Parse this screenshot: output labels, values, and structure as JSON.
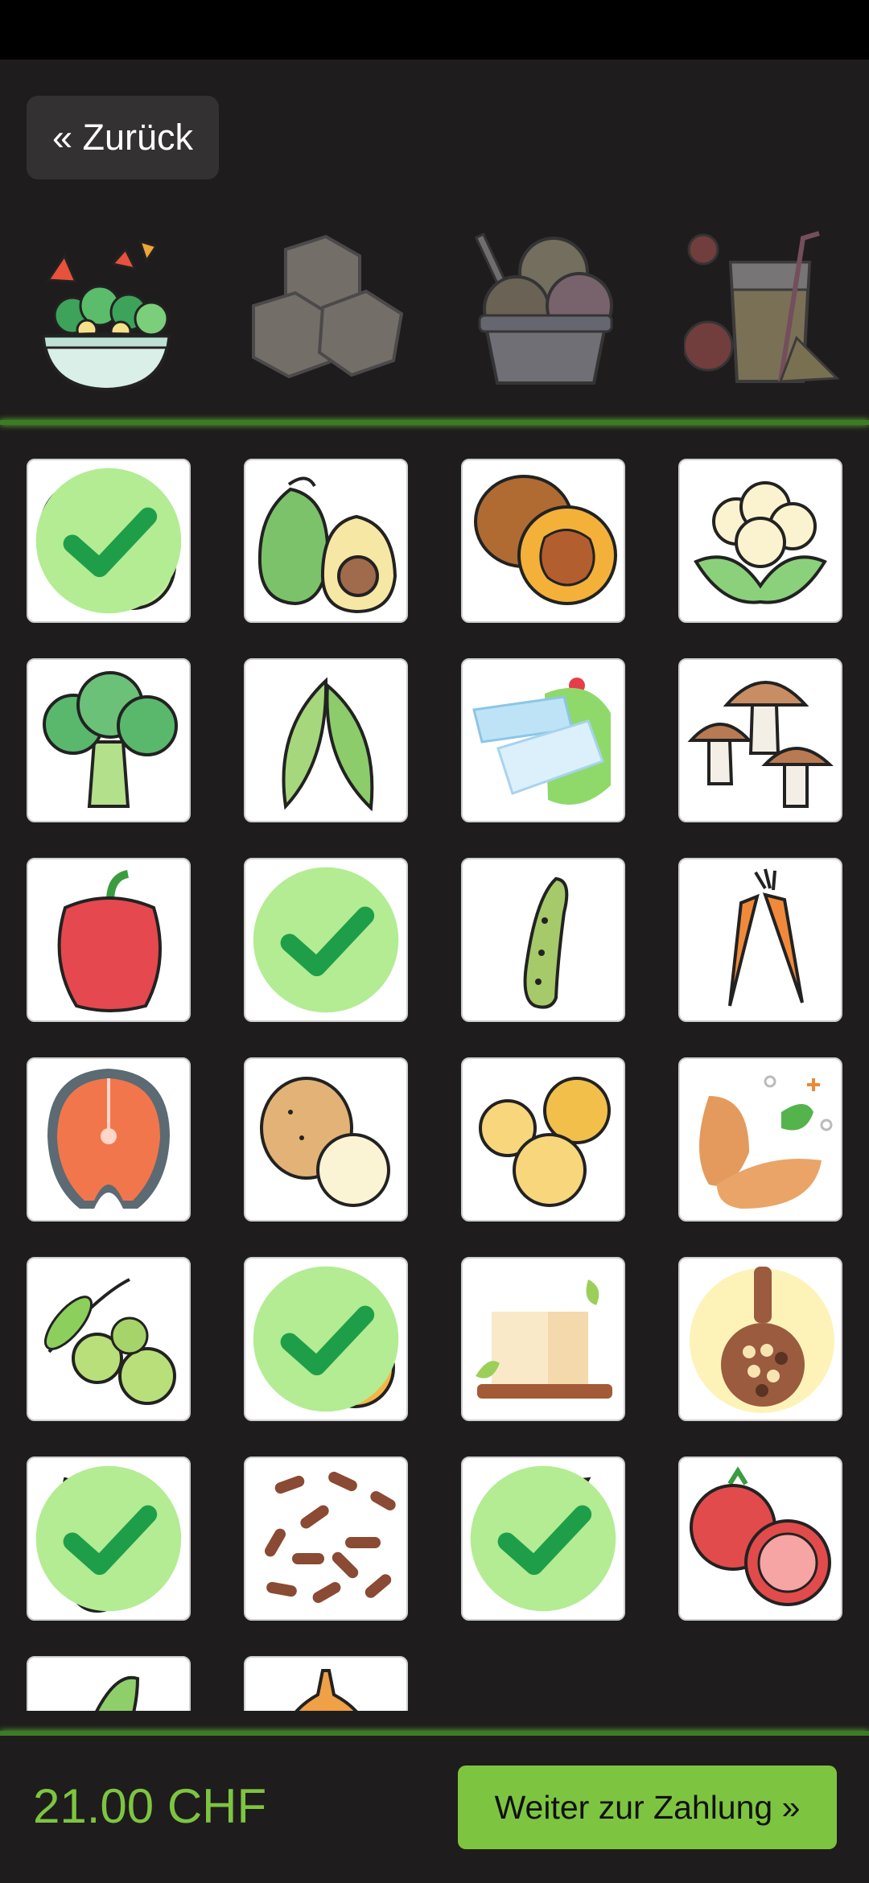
{
  "header": {
    "back_label": "« Zurück"
  },
  "categories": [
    {
      "icon": "salad-bowl-icon",
      "active": true
    },
    {
      "icon": "sugar-cubes-icon",
      "active": false
    },
    {
      "icon": "ice-cream-icon",
      "active": false
    },
    {
      "icon": "juice-icon",
      "active": false
    }
  ],
  "items": [
    {
      "icon": "apple-icon",
      "selected": true
    },
    {
      "icon": "avocado-icon",
      "selected": false
    },
    {
      "icon": "walnut-icon",
      "selected": false
    },
    {
      "icon": "cauliflower-icon",
      "selected": false
    },
    {
      "icon": "broccoli-icon",
      "selected": false
    },
    {
      "icon": "peas-icon",
      "selected": false
    },
    {
      "icon": "feta-cheese-icon",
      "selected": false
    },
    {
      "icon": "mushrooms-icon",
      "selected": false
    },
    {
      "icon": "bell-pepper-icon",
      "selected": false
    },
    {
      "icon": "lettuce-icon",
      "selected": true
    },
    {
      "icon": "pickle-icon",
      "selected": false
    },
    {
      "icon": "carrots-icon",
      "selected": false
    },
    {
      "icon": "salmon-steak-icon",
      "selected": false
    },
    {
      "icon": "potatoes-icon",
      "selected": false
    },
    {
      "icon": "chickpeas-icon",
      "selected": false
    },
    {
      "icon": "almonds-icon",
      "selected": false
    },
    {
      "icon": "olives-icon",
      "selected": false
    },
    {
      "icon": "orange-icon",
      "selected": true
    },
    {
      "icon": "tofu-icon",
      "selected": false
    },
    {
      "icon": "seeds-spoon-icon",
      "selected": false
    },
    {
      "icon": "radish-icon",
      "selected": true
    },
    {
      "icon": "rice-icon",
      "selected": false
    },
    {
      "icon": "sunflower-seeds-icon",
      "selected": true
    },
    {
      "icon": "tomato-icon",
      "selected": false
    },
    {
      "icon": "zucchini-icon",
      "selected": false
    },
    {
      "icon": "onion-icon",
      "selected": false
    }
  ],
  "footer": {
    "total": "21.00 CHF",
    "pay_label": "Weiter zur Zahlung »"
  },
  "colors": {
    "background": "#1f1c1d",
    "accent": "#7dc540",
    "divider": "#3a7d24",
    "check_bg": "#b3ec93",
    "check_mark": "#1f9e4a"
  }
}
